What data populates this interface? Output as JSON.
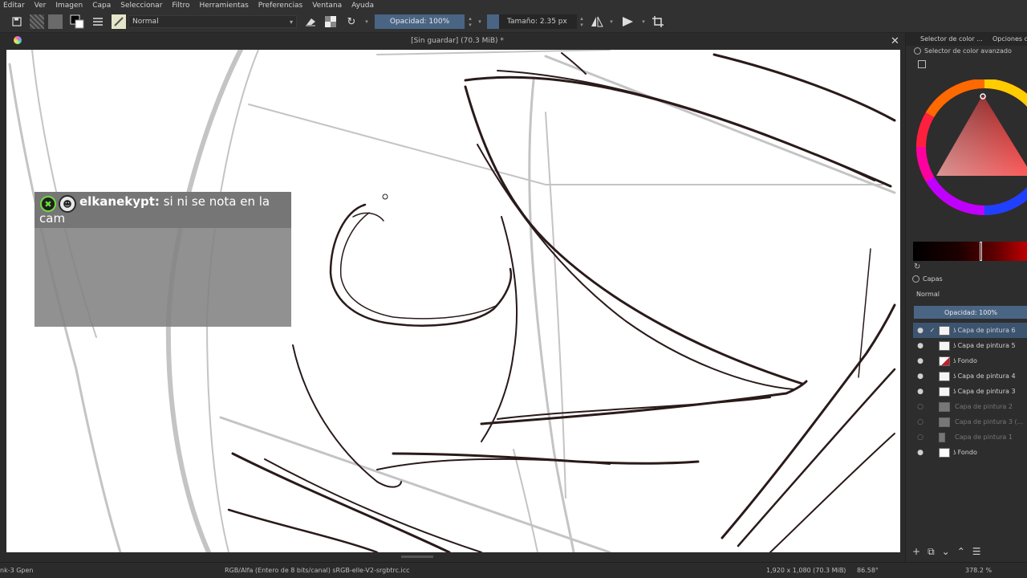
{
  "menu": [
    "Editar",
    "Ver",
    "Imagen",
    "Capa",
    "Seleccionar",
    "Filtro",
    "Herramientas",
    "Preferencias",
    "Ventana",
    "Ayuda"
  ],
  "toolbar": {
    "blend_mode": "Normal",
    "opacity": "Opacidad: 100%",
    "size": "Tamaño: 2.35 px",
    "icons": [
      "save-icon",
      "pattern-icon",
      "gradient-icon",
      "color-swap-icon",
      "brush-presets-icon",
      "brush-preview-icon",
      "eraser-icon",
      "alpha-lock-icon",
      "reload-icon",
      "mirror-horizontal-icon",
      "mirror-vertical-icon",
      "crop-icon"
    ]
  },
  "document": {
    "title": "[Sin guardar]  (70.3 MiB) *"
  },
  "chat": {
    "username": "elkanekypt:",
    "message": " si ni se nota en la cam"
  },
  "dock": {
    "tab_color": "Selector de color ...",
    "tab_options": "Opciones de",
    "color_subtitle": "Selector de color avanzado",
    "layers_title": "Capas",
    "layers_blend": "Normal",
    "layers_opacity": "Opacidad:  100%",
    "layers": [
      {
        "name": "Capa de pintura 6",
        "visible": true,
        "selected": true
      },
      {
        "name": "Capa de pintura 5",
        "visible": true,
        "selected": false
      },
      {
        "name": "Fondo",
        "visible": true,
        "selected": false
      },
      {
        "name": "Capa de pintura 4",
        "visible": true,
        "selected": false
      },
      {
        "name": "Capa de pintura 3",
        "visible": true,
        "selected": false
      },
      {
        "name": "Capa de pintura 2",
        "visible": false,
        "selected": false
      },
      {
        "name": "Capa de pintura 3 (...",
        "visible": false,
        "selected": false
      },
      {
        "name": "Capa de pintura 1",
        "visible": false,
        "selected": false
      },
      {
        "name": "Fondo",
        "visible": true,
        "selected": false
      }
    ]
  },
  "status": {
    "brush": "nk-3 Gpen",
    "color_space": "RGB/Alfa (Entero de 8 bits/canal)  sRGB-elle-V2-srgbtrc.icc",
    "dimensions": "1,920 x 1,080 (70.3 MiB)",
    "rotation": "86.58°",
    "zoom": "378.2 %"
  },
  "colors": {
    "accent": "#4a6584",
    "canvas": "#ffffff",
    "chat_bg": "#828282",
    "badge_green": "#6ddc3a"
  }
}
